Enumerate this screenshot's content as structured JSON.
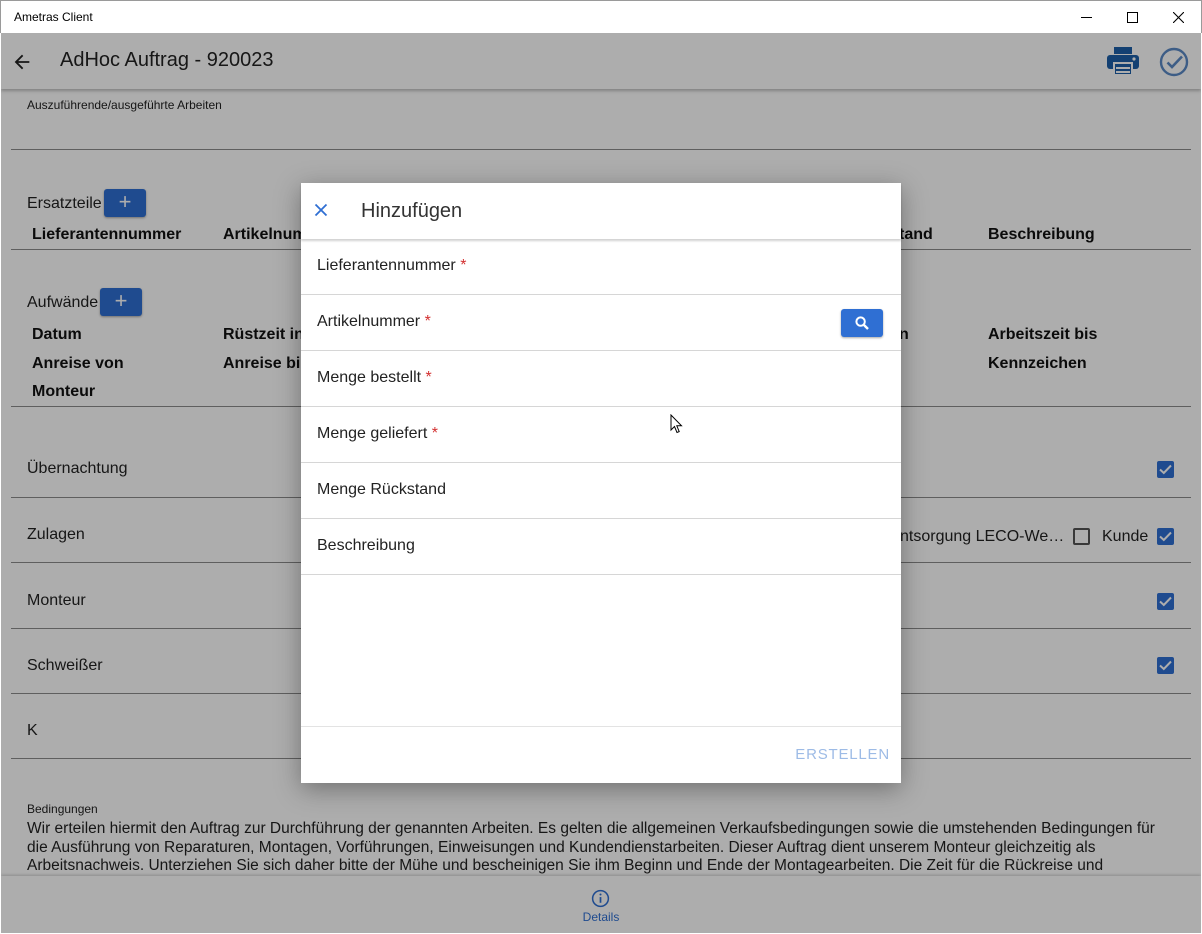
{
  "window": {
    "title": "Ametras Client"
  },
  "appbar": {
    "title": "AdHoc Auftrag - 920023"
  },
  "work": {
    "label": "Auszuführende/ausgeführte Arbeiten"
  },
  "ersatzteile": {
    "title": "Ersatzteile",
    "add_label": "+",
    "columns": [
      "Lieferantennummer",
      "Artikelnum",
      "tand",
      "Beschreibung"
    ]
  },
  "aufwaende": {
    "title": "Aufwände",
    "add_label": "+",
    "columns": [
      "Datum",
      "Rüstzeit in",
      "n",
      "Arbeitszeit bis",
      "Anreise von",
      "Anreise bi",
      "Kennzeichen",
      "Monteur"
    ]
  },
  "rows": {
    "uebernachtung": "Übernachtung",
    "zulagen": "Zulagen",
    "zulagen_text": "ntsorgung LECO-We…",
    "kunde": "Kunde",
    "monteur": "Monteur",
    "schweisser": "Schweißer",
    "k": "K"
  },
  "conditions": {
    "label": "Bedingungen",
    "text": "Wir erteilen hiermit den Auftrag zur Durchführung der genannten Arbeiten. Es gelten die allgemeinen Verkaufsbedingungen sowie die umstehenden Bedingungen für die Ausführung von Reparaturen, Montagen, Vorführungen, Einweisungen und Kundendienstarbeiten. Dieser Auftrag dient unserem Monteur gleichzeitig als Arbeitsnachweis. Unterziehen Sie sich daher bitte der Mühe und bescheinigen Sie ihm Beginn und Ende der Montagearbeiten. Die Zeit für die Rückreise und"
  },
  "bottom": {
    "details_label": "Details"
  },
  "dialog": {
    "title": "Hinzufügen",
    "close_icon": "close-icon",
    "fields": {
      "lieferantennummer": "Lieferantennummer",
      "artikelnummer": "Artikelnummer",
      "menge_bestellt": "Menge bestellt",
      "menge_geliefert": "Menge geliefert",
      "menge_rueckstand": "Menge Rückstand",
      "beschreibung": "Beschreibung"
    },
    "required_mark": "*",
    "create_label": "ERSTELLEN"
  },
  "colors": {
    "accent": "#2f6fd3",
    "required": "#d32f2f",
    "disabled_text": "#9dbbe6"
  }
}
